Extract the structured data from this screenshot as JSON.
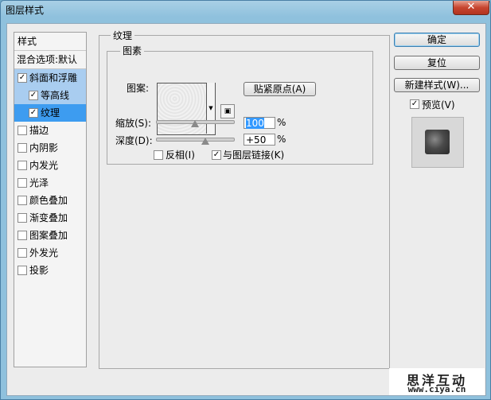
{
  "window": {
    "title": "图层样式",
    "close_glyph": "✕"
  },
  "sidebar": {
    "header": "样式",
    "blend_options": "混合选项:默认",
    "items": [
      {
        "label": "斜面和浮雕",
        "checked": true
      },
      {
        "label": "等高线",
        "checked": true
      },
      {
        "label": "纹理",
        "checked": true
      },
      {
        "label": "描边",
        "checked": false
      },
      {
        "label": "内阴影",
        "checked": false
      },
      {
        "label": "内发光",
        "checked": false
      },
      {
        "label": "光泽",
        "checked": false
      },
      {
        "label": "颜色叠加",
        "checked": false
      },
      {
        "label": "渐变叠加",
        "checked": false
      },
      {
        "label": "图案叠加",
        "checked": false
      },
      {
        "label": "外发光",
        "checked": false
      },
      {
        "label": "投影",
        "checked": false
      }
    ],
    "check_glyph": "✓"
  },
  "texture": {
    "group_title": "纹理",
    "subgroup_title": "图素",
    "pattern_label": "图案:",
    "snap_button": "贴紧原点(A)",
    "scale_label": "缩放(S):",
    "scale_value": "100",
    "scale_unit": "%",
    "depth_label": "深度(D):",
    "depth_value": "+50",
    "depth_unit": "%",
    "invert_label": "反相(I)",
    "invert_checked": false,
    "link_label": "与图层链接(K)",
    "link_checked": true,
    "arrow_glyph": "▼",
    "preset_glyph": "▣"
  },
  "buttons": {
    "ok": "确定",
    "reset": "复位",
    "new_style": "新建样式(W)..."
  },
  "preview": {
    "label": "预览(V)",
    "checked": true
  },
  "watermark": {
    "line1": "思洋互动",
    "line2": "www.ciya.cn"
  }
}
